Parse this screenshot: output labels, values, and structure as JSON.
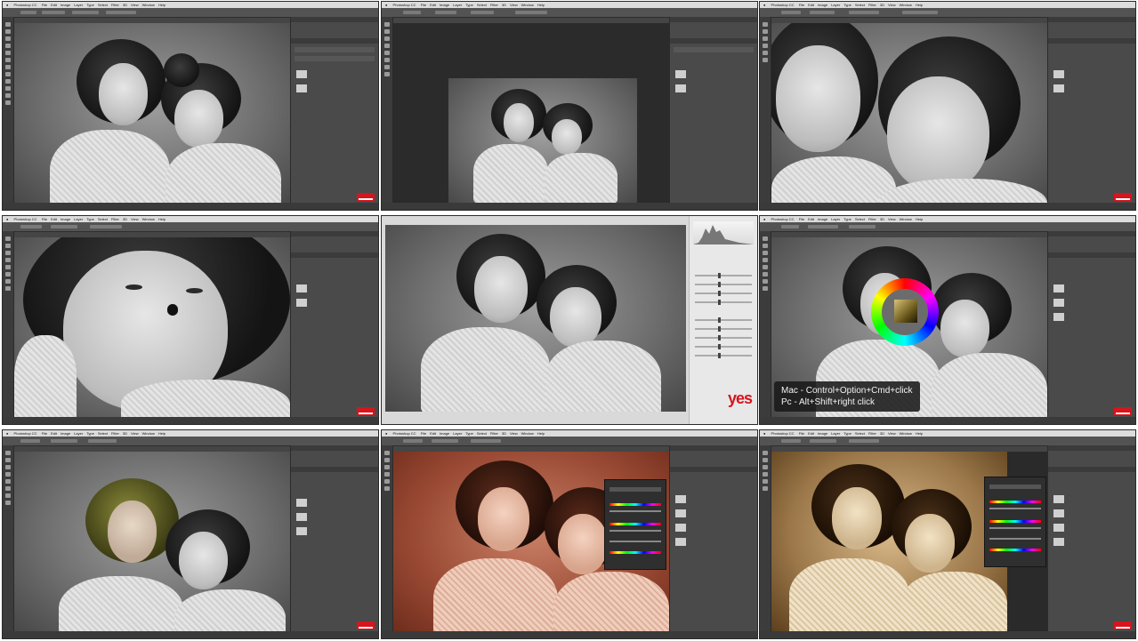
{
  "app_menu": {
    "app_name": "Photoshop CC",
    "items": [
      "File",
      "Edit",
      "Image",
      "Layer",
      "Type",
      "Select",
      "Filter",
      "3D",
      "View",
      "Window",
      "Help"
    ]
  },
  "shortcut_hint": {
    "line1": "Mac - Control+Option+Cmd+click",
    "line2": "Pc - Alt+Shift+right click"
  },
  "camera_raw": {
    "logo_text": "yes"
  },
  "colors": {
    "brand_red": "#d8141d",
    "ui_dark": "#454545",
    "sepia_light": "#d9b98a",
    "sepia_dark": "#5a3e1c",
    "peach": "#d88a6e"
  },
  "icons": [
    "apple-icon",
    "color-wheel-icon",
    "tool-icon",
    "layer-thumb-icon"
  ]
}
